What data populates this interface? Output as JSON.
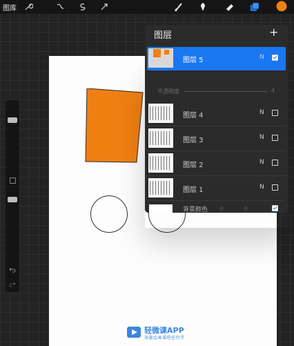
{
  "toolbar": {
    "gallery_label": "图库",
    "left_icons": [
      "wrench-icon",
      "magic-wand-icon",
      "selection-icon",
      "transform-arrow-icon"
    ],
    "right_icons": [
      "brush-icon",
      "smudge-icon",
      "eraser-icon",
      "layers-icon",
      "color-swatch-icon"
    ],
    "current_color": "#f07f12",
    "layers_icon_color": "#1a77f2"
  },
  "layers_panel": {
    "title": "图层",
    "add_glyph": "+",
    "opacity_label": "不透明度",
    "opacity_value": "4",
    "layers": [
      {
        "name": "图层 5",
        "mode": "N",
        "selected": true,
        "visible": true
      },
      {
        "name": "图层 4",
        "mode": "N",
        "selected": false,
        "visible": false
      },
      {
        "name": "图层 3",
        "mode": "N",
        "selected": false,
        "visible": false
      },
      {
        "name": "图层 2",
        "mode": "N",
        "selected": false,
        "visible": false
      },
      {
        "name": "图层 1",
        "mode": "N",
        "selected": false,
        "visible": false
      }
    ],
    "background": {
      "name": "背景颜色",
      "visible": true
    }
  },
  "watermark": {
    "title": "轻微课APP",
    "subtitle": "海量绘画课程任你学"
  },
  "colors": {
    "accent": "#1a77f2",
    "orange": "#f07f12",
    "canvas": "#fdfdfd"
  }
}
